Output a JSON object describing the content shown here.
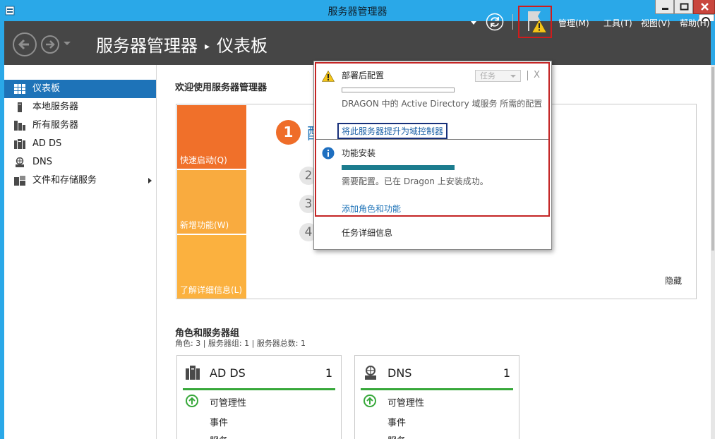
{
  "window": {
    "title": "服务器管理器"
  },
  "header": {
    "breadcrumb_root": "服务器管理器",
    "breadcrumb_sep": "▸",
    "breadcrumb_page": "仪表板",
    "menus": [
      "管理(M)",
      "工具(T)",
      "视图(V)",
      "帮助(H)"
    ]
  },
  "sidebar": {
    "items": [
      {
        "label": "仪表板",
        "icon": "dashboard-icon",
        "active": true
      },
      {
        "label": "本地服务器",
        "icon": "local-server-icon"
      },
      {
        "label": "所有服务器",
        "icon": "all-servers-icon"
      },
      {
        "label": "AD DS",
        "icon": "ad-ds-icon"
      },
      {
        "label": "DNS",
        "icon": "dns-icon"
      },
      {
        "label": "文件和存储服务",
        "icon": "file-storage-icon",
        "has_submenu": true
      }
    ]
  },
  "welcome": {
    "title": "欢迎使用服务器管理器",
    "tiles": [
      "快速启动(Q)",
      "新增功能(W)",
      "了解详细信息(L)"
    ],
    "step1_number": "1",
    "step1_text": "配",
    "steps": [
      "2",
      "3",
      "4"
    ],
    "hide": "隐藏"
  },
  "roles": {
    "title": "角色和服务器组",
    "subtitle": "角色: 3 | 服务器组: 1 | 服务器总数: 1",
    "cards": [
      {
        "name": "AD DS",
        "count": "1",
        "manageability": "可管理性",
        "events": "事件",
        "services": "服务"
      },
      {
        "name": "DNS",
        "count": "1",
        "manageability": "可管理性",
        "events": "事件",
        "services": "服务"
      }
    ]
  },
  "notifications": {
    "task_button": "任务",
    "close": "X",
    "items": [
      {
        "title": "部署后配置",
        "desc": "DRAGON 中的 Active Directory 域服务 所需的配置",
        "link": "将此服务器提升为域控制器",
        "progress": 0
      },
      {
        "title": "功能安装",
        "desc": "需要配置。已在 Dragon 上安装成功。",
        "link": "添加角色和功能",
        "progress": 1
      }
    ],
    "task_details": "任务详细信息"
  },
  "colors": {
    "accent": "#2aa8e8",
    "header_bg": "#464646",
    "sidebar_active": "#1e73b8",
    "tile_orange": "#f0702a",
    "tile_yellow": "#f9ab3f",
    "status_green": "#37a83a",
    "highlight_red": "#c42424"
  }
}
